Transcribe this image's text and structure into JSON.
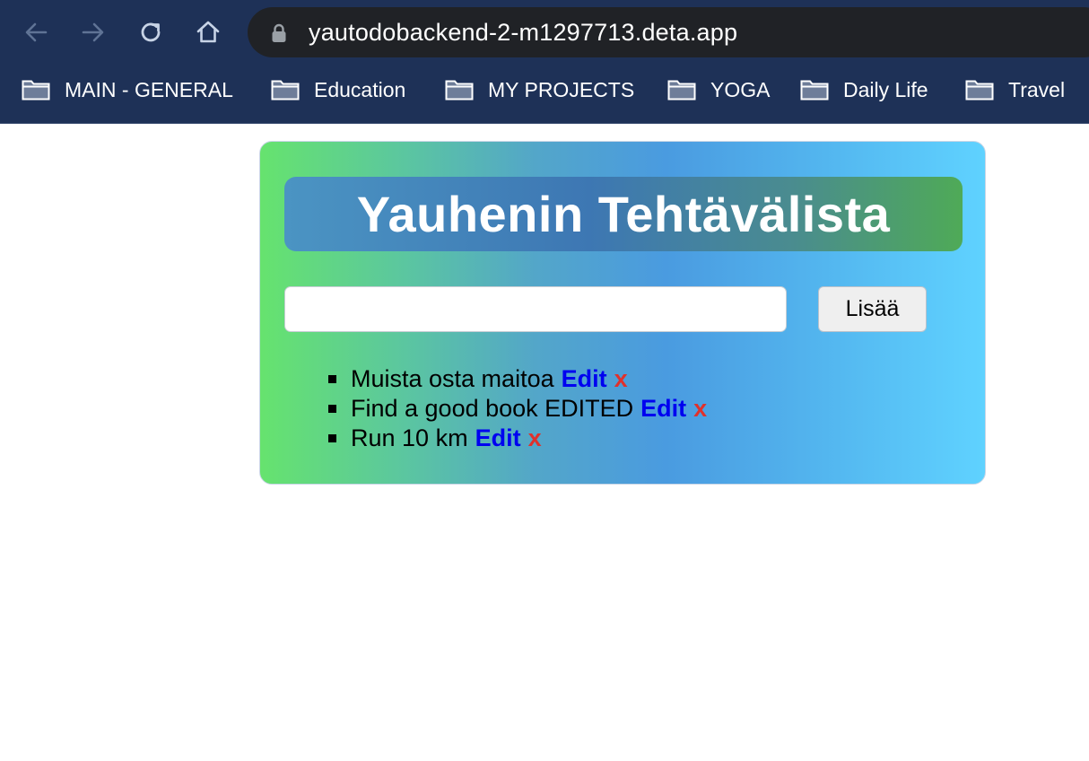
{
  "browser": {
    "url": "yautodobackend-2-m1297713.deta.app",
    "bookmarks": [
      {
        "label": "MAIN - GENERAL"
      },
      {
        "label": "Education"
      },
      {
        "label": "MY PROJECTS"
      },
      {
        "label": "YOGA"
      },
      {
        "label": "Daily Life"
      },
      {
        "label": "Travel"
      }
    ],
    "icons": {
      "back": "arrow-left-icon",
      "forward": "arrow-right-icon",
      "reload": "reload-icon",
      "home": "home-icon",
      "lock": "lock-icon",
      "folder": "folder-icon"
    }
  },
  "app": {
    "title": "Yauhenin Tehtävälista",
    "input_value": "",
    "add_button_label": "Lisää",
    "todos": [
      {
        "text": "Muista osta maitoa",
        "edit_label": "Edit",
        "delete_label": "x"
      },
      {
        "text": "Find a good book EDITED",
        "edit_label": "Edit",
        "delete_label": "x"
      },
      {
        "text": "Run 10 km",
        "edit_label": "Edit",
        "delete_label": "x"
      }
    ],
    "colors": {
      "edit_link": "#0000f0",
      "delete_link": "#e0312c",
      "title_text": "#ffffff"
    }
  }
}
